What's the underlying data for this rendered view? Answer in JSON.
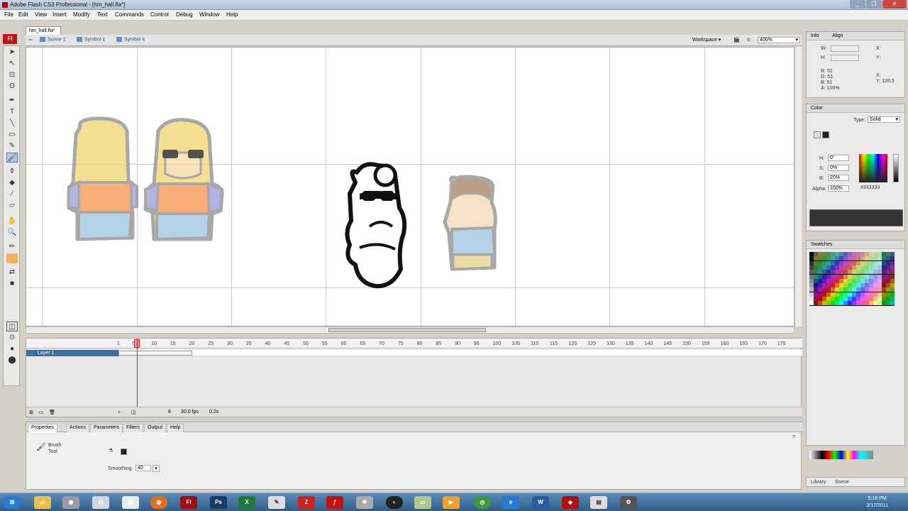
{
  "window": {
    "title": "Adobe Flash CS3 Professional - [hm_hall.fla*]"
  },
  "menu": [
    "File",
    "Edit",
    "View",
    "Insert",
    "Modify",
    "Text",
    "Commands",
    "Control",
    "Debug",
    "Window",
    "Help"
  ],
  "tools": {
    "logo": "Fl"
  },
  "document": {
    "tab": "hm_hall.fla*"
  },
  "breadcrumb": [
    "Scene 1",
    "Symbol 1",
    "Symbol 4"
  ],
  "stage_toolbar": {
    "workspace": "Workspace",
    "zoom": "400%"
  },
  "timeline": {
    "ruler": [
      "1",
      "5",
      "10",
      "15",
      "20",
      "25",
      "30",
      "35",
      "40",
      "45",
      "50",
      "55",
      "60",
      "65",
      "70",
      "75",
      "80",
      "85",
      "90",
      "95",
      "100",
      "105",
      "110",
      "115",
      "120",
      "125",
      "130",
      "135",
      "140",
      "145",
      "150",
      "155",
      "160",
      "165",
      "170",
      "175"
    ],
    "layer": "Layer 1",
    "current_frame": "6",
    "fps": "30.0 fps",
    "time": "0.2s"
  },
  "properties": {
    "tabs": [
      "Properties",
      "Actions",
      "Parameters",
      "Filters",
      "Output",
      "Help"
    ],
    "tool_name": "Brush",
    "tool_sub": "Tool",
    "smoothing_label": "Smoothing",
    "smoothing_value": "40"
  },
  "info": {
    "tabs": [
      "Info",
      "Align"
    ],
    "w_label": "W:",
    "h_label": "H:",
    "x_label": "X:",
    "y_label": "Y:",
    "r": "R: 51",
    "g": "G: 51",
    "b": "B: 51",
    "a": "A: 100%",
    "cx_label": "X:",
    "cy": "Y: 128.3"
  },
  "color": {
    "tab": "Color",
    "type_label": "Type:",
    "type_value": "Solid",
    "h_label": "H:",
    "h_value": "0°",
    "s_label": "S:",
    "s_value": "0%",
    "b_label": "B:",
    "b_value": "20%",
    "alpha_label": "Alpha:",
    "alpha_value": "100%",
    "hex": "#333333"
  },
  "swatches": {
    "tab": "Swatches"
  },
  "library_tabs": [
    "Library",
    "Scene"
  ],
  "taskbar": {
    "time": "5:10 PM",
    "date": "3/17/2011"
  }
}
